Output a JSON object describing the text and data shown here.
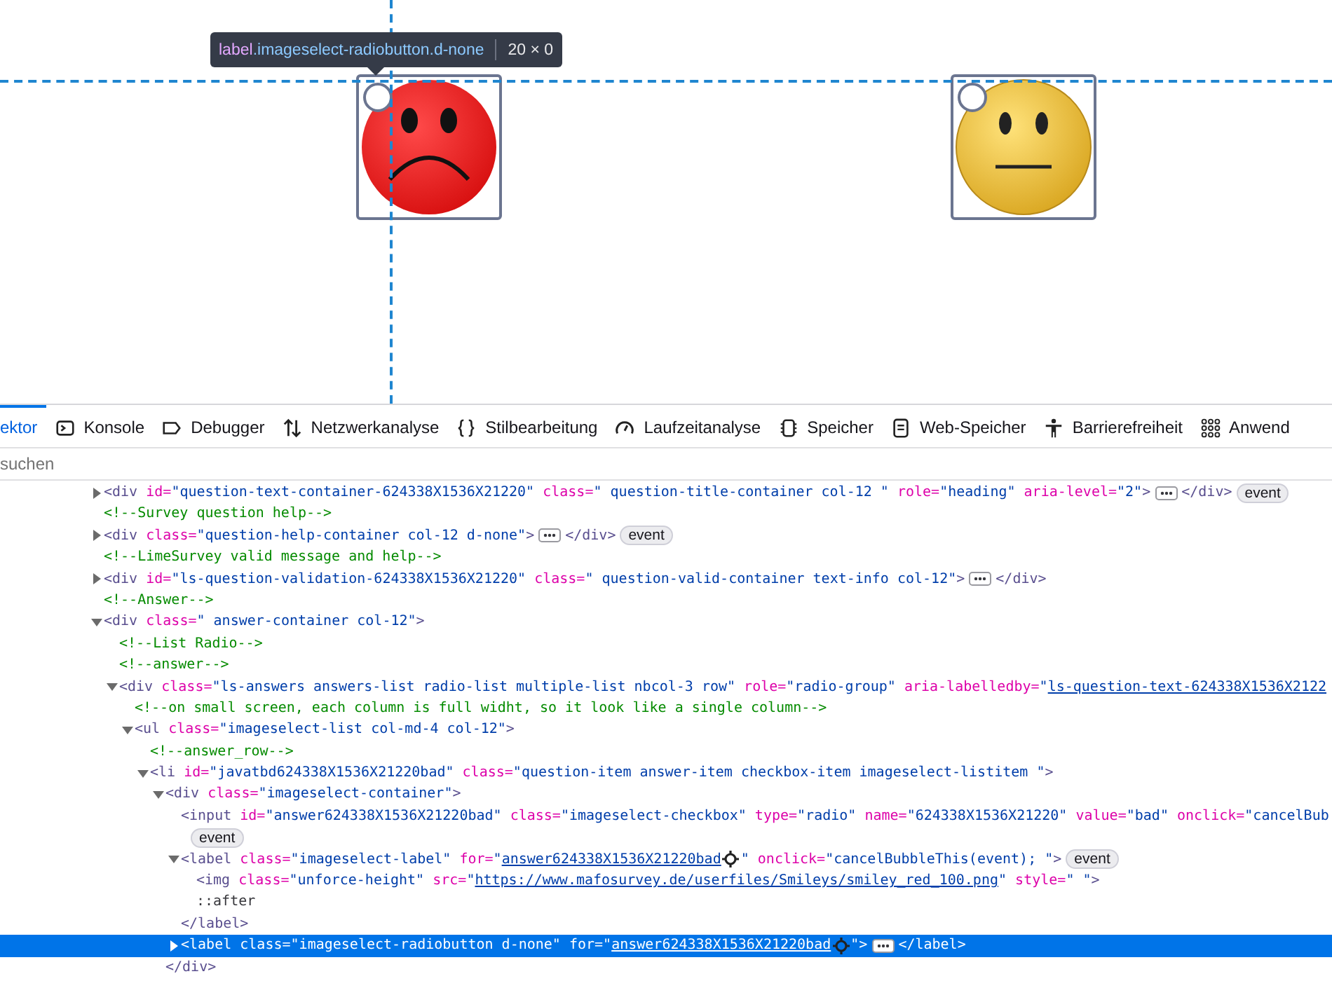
{
  "page": {
    "tooltip": {
      "tag": "label",
      "classes": ".imageselect-radiobutton.d-none",
      "size": "20 × 0"
    },
    "answers": [
      {
        "kind": "sad",
        "checked": false
      },
      {
        "kind": "neutral",
        "checked": false
      }
    ]
  },
  "tabs": [
    {
      "label": "ektor",
      "selected": true
    },
    {
      "label": "Konsole",
      "selected": false
    },
    {
      "label": "Debugger",
      "selected": false
    },
    {
      "label": "Netzwerkanalyse",
      "selected": false
    },
    {
      "label": "Stilbearbeitung",
      "selected": false
    },
    {
      "label": "Laufzeitanalyse",
      "selected": false
    },
    {
      "label": "Speicher",
      "selected": false
    },
    {
      "label": "Web-Speicher",
      "selected": false
    },
    {
      "label": "Barrierefreiheit",
      "selected": false
    },
    {
      "label": "Anwend",
      "selected": false
    }
  ],
  "search": {
    "placeholder": "suchen"
  },
  "tree": [
    {
      "expanded": false,
      "selected": false,
      "segments": [
        {
          "kind": "tag",
          "text": "<div"
        },
        {
          "kind": "attr",
          "text": " id="
        },
        {
          "kind": "value",
          "text": "\"question-text-container-624338X1536X21220\""
        },
        {
          "kind": "attr",
          "text": " class="
        },
        {
          "kind": "value",
          "text": "\" question-title-container col-12 \""
        },
        {
          "kind": "attr",
          "text": " role="
        },
        {
          "kind": "value",
          "text": "\"heading\""
        },
        {
          "kind": "attr",
          "text": " aria-level="
        },
        {
          "kind": "value",
          "text": "\"2\""
        },
        {
          "kind": "tag",
          "text": ">"
        },
        {
          "kind": "more"
        },
        {
          "kind": "tag",
          "text": "</div>"
        },
        {
          "kind": "badge",
          "text": "event"
        }
      ]
    },
    {
      "selected": false,
      "segments": [
        {
          "kind": "comment",
          "text": "<!--Survey question help-->"
        }
      ]
    },
    {
      "expanded": false,
      "selected": false,
      "segments": [
        {
          "kind": "tag",
          "text": "<div"
        },
        {
          "kind": "attr",
          "text": " class="
        },
        {
          "kind": "value",
          "text": "\"question-help-container col-12 d-none\""
        },
        {
          "kind": "tag",
          "text": ">"
        },
        {
          "kind": "more"
        },
        {
          "kind": "tag",
          "text": "</div>"
        },
        {
          "kind": "badge",
          "text": "event"
        }
      ]
    },
    {
      "selected": false,
      "segments": [
        {
          "kind": "comment",
          "text": "<!--LimeSurvey valid message and help-->"
        }
      ]
    },
    {
      "expanded": false,
      "selected": false,
      "segments": [
        {
          "kind": "tag",
          "text": "<div"
        },
        {
          "kind": "attr",
          "text": " id="
        },
        {
          "kind": "value",
          "text": "\"ls-question-validation-624338X1536X21220\""
        },
        {
          "kind": "attr",
          "text": " class="
        },
        {
          "kind": "value",
          "text": "\" question-valid-container text-info col-12\""
        },
        {
          "kind": "tag",
          "text": ">"
        },
        {
          "kind": "more"
        },
        {
          "kind": "tag",
          "text": "</div>"
        }
      ]
    },
    {
      "selected": false,
      "segments": [
        {
          "kind": "comment",
          "text": "<!--Answer-->"
        }
      ]
    },
    {
      "expanded": true,
      "selected": false,
      "segments": [
        {
          "kind": "tag",
          "text": "<div"
        },
        {
          "kind": "attr",
          "text": " class="
        },
        {
          "kind": "value",
          "text": "\" answer-container col-12\""
        },
        {
          "kind": "tag",
          "text": ">"
        }
      ],
      "children": [
        {
          "selected": false,
          "segments": [
            {
              "kind": "comment",
              "text": "<!--List Radio-->"
            }
          ]
        },
        {
          "selected": false,
          "segments": [
            {
              "kind": "comment",
              "text": "<!--answer-->"
            }
          ]
        },
        {
          "expanded": true,
          "selected": false,
          "segments": [
            {
              "kind": "tag",
              "text": "<div"
            },
            {
              "kind": "attr",
              "text": " class="
            },
            {
              "kind": "value",
              "text": "\"ls-answers answers-list radio-list multiple-list nbcol-3 row\""
            },
            {
              "kind": "attr",
              "text": " role="
            },
            {
              "kind": "value",
              "text": "\"radio-group\""
            },
            {
              "kind": "attr",
              "text": " aria-labelledby="
            },
            {
              "kind": "value",
              "text": "\""
            },
            {
              "kind": "link",
              "text": "ls-question-text-624338X1536X2122"
            }
          ],
          "children": [
            {
              "selected": false,
              "segments": [
                {
                  "kind": "comment",
                  "text": "<!--on small screen, each column is full widht, so it look like a single column-->"
                }
              ]
            },
            {
              "expanded": true,
              "selected": false,
              "segments": [
                {
                  "kind": "tag",
                  "text": "<ul"
                },
                {
                  "kind": "attr",
                  "text": " class="
                },
                {
                  "kind": "value",
                  "text": "\"imageselect-list col-md-4 col-12\""
                },
                {
                  "kind": "tag",
                  "text": ">"
                }
              ],
              "children": [
                {
                  "selected": false,
                  "segments": [
                    {
                      "kind": "comment",
                      "text": "<!--answer_row-->"
                    }
                  ]
                },
                {
                  "expanded": true,
                  "selected": false,
                  "segments": [
                    {
                      "kind": "tag",
                      "text": "<li"
                    },
                    {
                      "kind": "attr",
                      "text": " id="
                    },
                    {
                      "kind": "value",
                      "text": "\"javatbd624338X1536X21220bad\""
                    },
                    {
                      "kind": "attr",
                      "text": " class="
                    },
                    {
                      "kind": "value",
                      "text": "\"question-item answer-item checkbox-item imageselect-listitem \""
                    },
                    {
                      "kind": "tag",
                      "text": ">"
                    }
                  ],
                  "children": [
                    {
                      "expanded": true,
                      "selected": false,
                      "segments": [
                        {
                          "kind": "tag",
                          "text": "<div"
                        },
                        {
                          "kind": "attr",
                          "text": " class="
                        },
                        {
                          "kind": "value",
                          "text": "\"imageselect-container\""
                        },
                        {
                          "kind": "tag",
                          "text": ">"
                        }
                      ],
                      "children": [
                        {
                          "selected": false,
                          "segments": [
                            {
                              "kind": "tag",
                              "text": "<input"
                            },
                            {
                              "kind": "attr",
                              "text": " id="
                            },
                            {
                              "kind": "value",
                              "text": "\"answer624338X1536X21220bad\""
                            },
                            {
                              "kind": "attr",
                              "text": " class="
                            },
                            {
                              "kind": "value",
                              "text": "\"imageselect-checkbox\""
                            },
                            {
                              "kind": "attr",
                              "text": " type="
                            },
                            {
                              "kind": "value",
                              "text": "\"radio\""
                            },
                            {
                              "kind": "attr",
                              "text": " name="
                            },
                            {
                              "kind": "value",
                              "text": "\"624338X1536X21220\""
                            },
                            {
                              "kind": "attr",
                              "text": " value="
                            },
                            {
                              "kind": "value",
                              "text": "\"bad\""
                            },
                            {
                              "kind": "attr",
                              "text": " onclick="
                            },
                            {
                              "kind": "value",
                              "text": "\"cancelBub"
                            },
                            {
                              "kind": "break"
                            },
                            {
                              "kind": "badge",
                              "text": "event"
                            }
                          ]
                        },
                        {
                          "expanded": true,
                          "selected": false,
                          "segments": [
                            {
                              "kind": "tag",
                              "text": "<label"
                            },
                            {
                              "kind": "attr",
                              "text": " class="
                            },
                            {
                              "kind": "value",
                              "text": "\"imageselect-label\""
                            },
                            {
                              "kind": "attr",
                              "text": " for="
                            },
                            {
                              "kind": "value",
                              "text": "\""
                            },
                            {
                              "kind": "link",
                              "text": "answer624338X1536X21220bad"
                            },
                            {
                              "kind": "pick"
                            },
                            {
                              "kind": "value",
                              "text": "\""
                            },
                            {
                              "kind": "attr",
                              "text": " onclick="
                            },
                            {
                              "kind": "value",
                              "text": "\"cancelBubbleThis(event); \""
                            },
                            {
                              "kind": "tag",
                              "text": ">"
                            },
                            {
                              "kind": "badge",
                              "text": "event"
                            }
                          ],
                          "children": [
                            {
                              "selected": false,
                              "segments": [
                                {
                                  "kind": "tag",
                                  "text": "<img"
                                },
                                {
                                  "kind": "attr",
                                  "text": " class="
                                },
                                {
                                  "kind": "value",
                                  "text": "\"unforce-height\""
                                },
                                {
                                  "kind": "attr",
                                  "text": " src="
                                },
                                {
                                  "kind": "value",
                                  "text": "\""
                                },
                                {
                                  "kind": "link",
                                  "text": "https://www.mafosurvey.de/userfiles/Smileys/smiley_red_100.png"
                                },
                                {
                                  "kind": "value",
                                  "text": "\""
                                },
                                {
                                  "kind": "attr",
                                  "text": " style="
                                },
                                {
                                  "kind": "value",
                                  "text": "\" \""
                                },
                                {
                                  "kind": "tag",
                                  "text": ">"
                                }
                              ]
                            },
                            {
                              "selected": false,
                              "segments": [
                                {
                                  "kind": "plain",
                                  "text": "::after"
                                }
                              ]
                            }
                          ]
                        },
                        {
                          "selected": false,
                          "segments": [
                            {
                              "kind": "tag",
                              "text": "</label>"
                            }
                          ]
                        },
                        {
                          "expanded": false,
                          "selected": true,
                          "segments": [
                            {
                              "kind": "tag",
                              "text": "<label"
                            },
                            {
                              "kind": "attr",
                              "text": " class="
                            },
                            {
                              "kind": "value",
                              "text": "\"imageselect-radiobutton d-none\""
                            },
                            {
                              "kind": "attr",
                              "text": " for="
                            },
                            {
                              "kind": "value",
                              "text": "\""
                            },
                            {
                              "kind": "link",
                              "text": "answer624338X1536X21220bad"
                            },
                            {
                              "kind": "pick"
                            },
                            {
                              "kind": "value",
                              "text": "\""
                            },
                            {
                              "kind": "tag",
                              "text": ">"
                            },
                            {
                              "kind": "more"
                            },
                            {
                              "kind": "tag",
                              "text": "</label>"
                            }
                          ]
                        }
                      ]
                    },
                    {
                      "selected": false,
                      "segments": [
                        {
                          "kind": "tag",
                          "text": "</div>"
                        }
                      ]
                    }
                  ]
                }
              ]
            }
          ]
        }
      ]
    }
  ]
}
